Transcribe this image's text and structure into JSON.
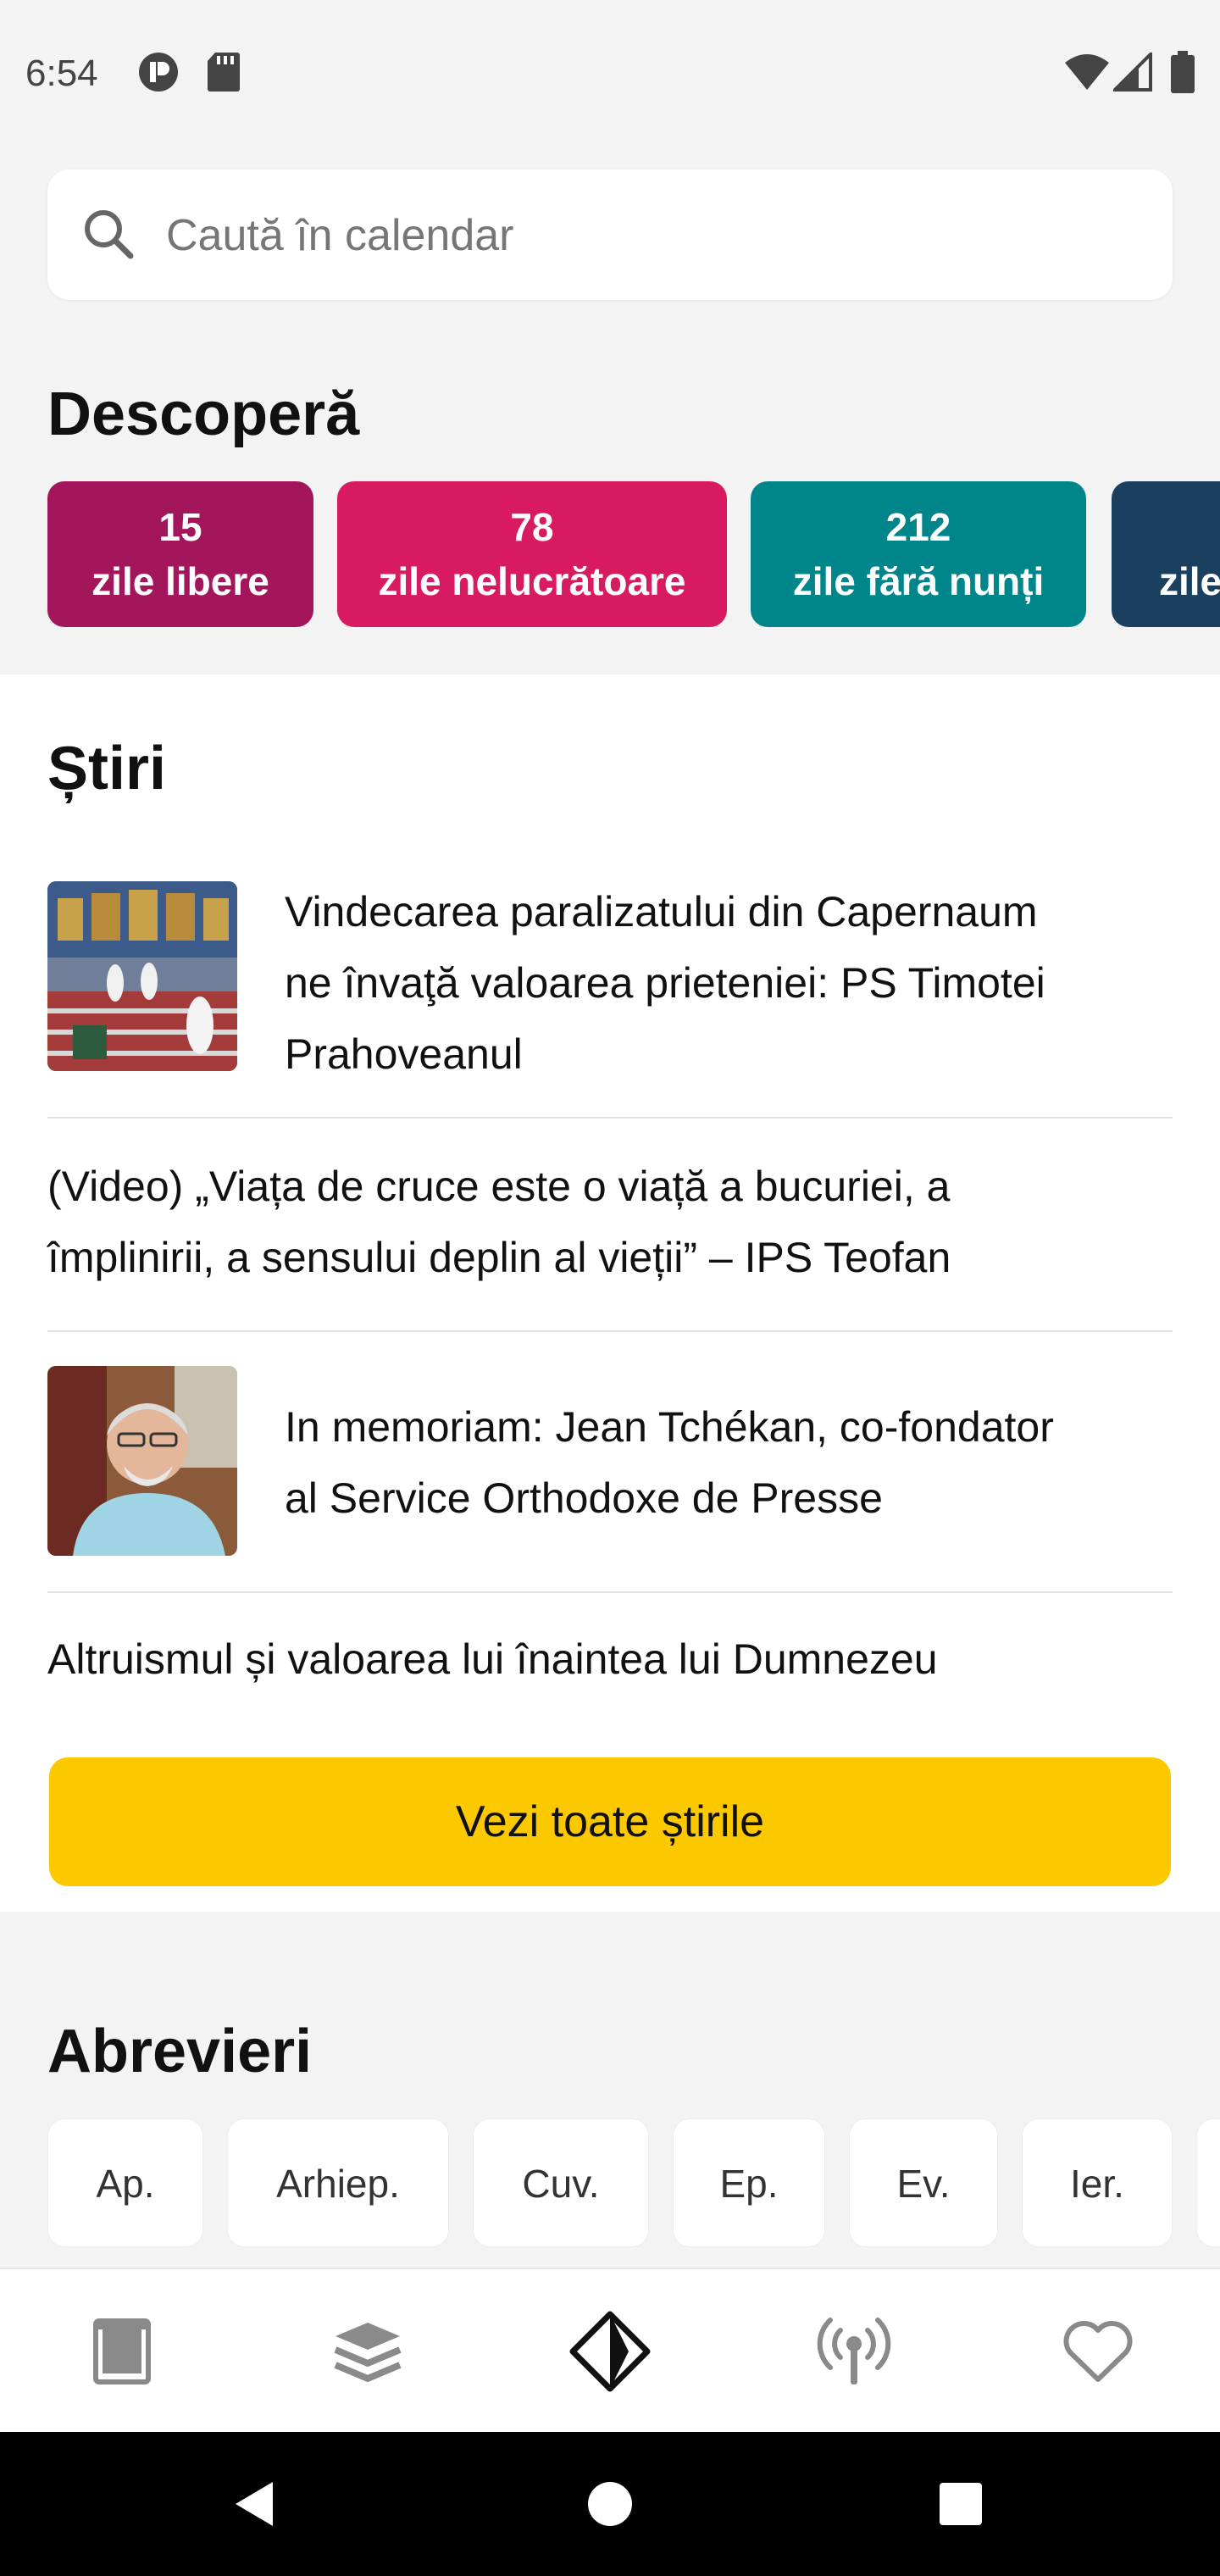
{
  "status_bar": {
    "time": "6:54"
  },
  "search": {
    "placeholder": "Caută în calendar"
  },
  "discover": {
    "title": "Descoperă",
    "chips": [
      {
        "number": "15",
        "label": "zile libere",
        "color": "#a3165c"
      },
      {
        "number": "78",
        "label": "zile nelucrătoare",
        "color": "#d81b60"
      },
      {
        "number": "212",
        "label": "zile fără nunți",
        "color": "#00868a"
      },
      {
        "number": "",
        "label": "zile",
        "color": "#1b3f5e"
      }
    ]
  },
  "news": {
    "title": "Știri",
    "items": [
      {
        "title_lines": [
          "Vindecarea paralizatului din Capernaum",
          "ne învaţă valoarea prieteniei: PS Timotei",
          "Prahoveanul"
        ],
        "has_image": true
      },
      {
        "title_lines": [
          "(Video) „Viața de cruce este o viață a bucuriei, a",
          "împlinirii, a sensului deplin al vieții” – IPS Teofan"
        ],
        "has_image": false
      },
      {
        "title_lines": [
          "In memoriam: Jean Tchékan, co-fondator",
          "al Service Orthodoxe de Presse"
        ],
        "has_image": true
      },
      {
        "title_lines": [
          "Altruismul și valoarea lui înaintea lui Dumnezeu"
        ],
        "has_image": false
      }
    ],
    "all_button": "Vezi toate știrile"
  },
  "abbreviations": {
    "title": "Abrevieri",
    "items": [
      "Ap.",
      "Arhiep.",
      "Cuv.",
      "Ep.",
      "Ev.",
      "Ier."
    ]
  },
  "bottom_nav": {
    "items": [
      {
        "icon": "calendar-page-icon",
        "active": false
      },
      {
        "icon": "layers-icon",
        "active": false
      },
      {
        "icon": "discover-diamond-icon",
        "active": true
      },
      {
        "icon": "radio-broadcast-icon",
        "active": false
      },
      {
        "icon": "heart-icon",
        "active": false
      }
    ]
  },
  "colors": {
    "accent_yellow": "#fcc800",
    "icon_gray": "#8a8a8a"
  }
}
